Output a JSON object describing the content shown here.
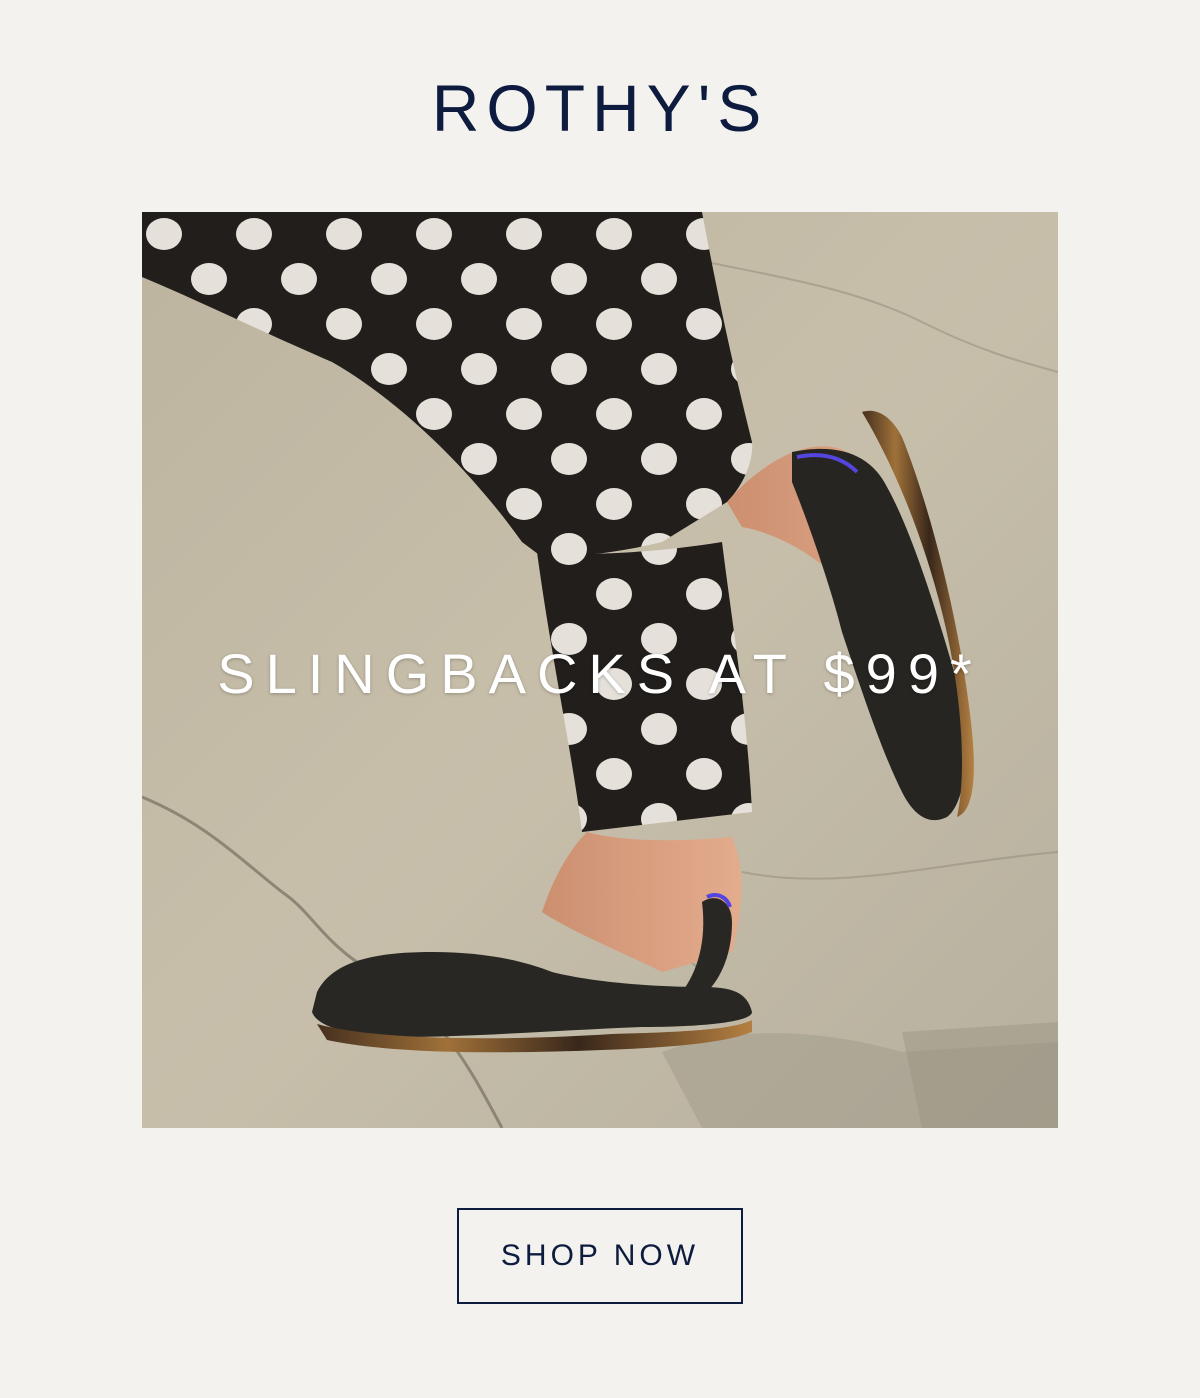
{
  "brand": {
    "logo_text": "ROTHY'S",
    "color": "#0d1b3e"
  },
  "hero": {
    "image_alt": "Person walking in black slingback flats and black polka-dot pants on pavement",
    "headline": "SLINGBACKS AT $99*",
    "headline_color": "#ffffff"
  },
  "cta": {
    "label": "SHOP NOW"
  },
  "colors": {
    "page_background": "#f3f2ef",
    "accent_navy": "#0d1b3e"
  }
}
